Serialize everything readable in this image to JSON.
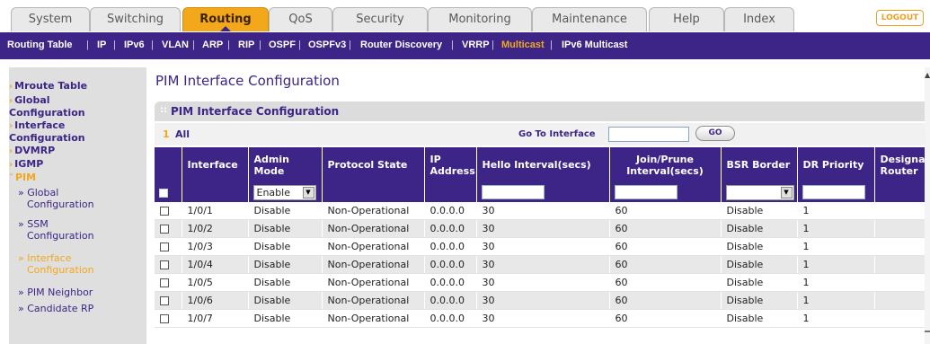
{
  "top_tabs": [
    "System",
    "Switching",
    "Routing",
    "QoS",
    "Security",
    "Monitoring",
    "Maintenance",
    "Help",
    "Index"
  ],
  "active_tab": "Routing",
  "logout_label": "LOGOUT",
  "sub_nav": [
    "Routing Table",
    "IP",
    "IPv6",
    "VLAN",
    "ARP",
    "RIP",
    "OSPF",
    "OSPFv3",
    "Router Discovery",
    "VRRP",
    "Multicast",
    "IPv6 Multicast"
  ],
  "active_sub_nav": "Multicast",
  "sidebar": {
    "items": [
      {
        "label": "Mroute Table"
      },
      {
        "label_line1": "Global",
        "label_line2": "Configuration"
      },
      {
        "label_line1": "Interface",
        "label_line2": "Configuration"
      },
      {
        "label": "DVMRP"
      },
      {
        "label": "IGMP"
      },
      {
        "label": "PIM"
      }
    ],
    "pim_sub": [
      {
        "line1": "» Global",
        "line2": "Configuration"
      },
      {
        "line1": "» SSM",
        "line2": "Configuration"
      },
      {
        "line1": "» Interface",
        "line2": "Configuration"
      },
      {
        "line1": "» PIM Neighbor"
      },
      {
        "line1": "» Candidate RP"
      }
    ]
  },
  "page_title": "PIM Interface Configuration",
  "panel_title": "PIM Interface Configuration",
  "toolbar": {
    "number": "1",
    "all_label": "All",
    "goto_label": "Go To Interface",
    "go_button": "GO"
  },
  "table": {
    "headers": [
      "Interface",
      "Admin Mode",
      "Protocol State",
      "IP Address",
      "Hello Interval(secs)",
      "Join/Prune Interval(secs)",
      "BSR Border",
      "DR Priority",
      "Designated Router"
    ],
    "edit_row": {
      "admin_mode": "Enable"
    },
    "rows": [
      {
        "interface": "1/0/1",
        "admin_mode": "Disable",
        "protocol_state": "Non-Operational",
        "ip": "0.0.0.0",
        "hello": "30",
        "join_prune": "60",
        "bsr": "Disable",
        "dr": "1"
      },
      {
        "interface": "1/0/2",
        "admin_mode": "Disable",
        "protocol_state": "Non-Operational",
        "ip": "0.0.0.0",
        "hello": "30",
        "join_prune": "60",
        "bsr": "Disable",
        "dr": "1"
      },
      {
        "interface": "1/0/3",
        "admin_mode": "Disable",
        "protocol_state": "Non-Operational",
        "ip": "0.0.0.0",
        "hello": "30",
        "join_prune": "60",
        "bsr": "Disable",
        "dr": "1"
      },
      {
        "interface": "1/0/4",
        "admin_mode": "Disable",
        "protocol_state": "Non-Operational",
        "ip": "0.0.0.0",
        "hello": "30",
        "join_prune": "60",
        "bsr": "Disable",
        "dr": "1"
      },
      {
        "interface": "1/0/5",
        "admin_mode": "Disable",
        "protocol_state": "Non-Operational",
        "ip": "0.0.0.0",
        "hello": "30",
        "join_prune": "60",
        "bsr": "Disable",
        "dr": "1"
      },
      {
        "interface": "1/0/6",
        "admin_mode": "Disable",
        "protocol_state": "Non-Operational",
        "ip": "0.0.0.0",
        "hello": "30",
        "join_prune": "60",
        "bsr": "Disable",
        "dr": "1"
      },
      {
        "interface": "1/0/7",
        "admin_mode": "Disable",
        "protocol_state": "Non-Operational",
        "ip": "0.0.0.0",
        "hello": "30",
        "join_prune": "60",
        "bsr": "Disable",
        "dr": "1"
      }
    ]
  },
  "colors": {
    "brand_purple": "#3c2587",
    "accent_orange": "#f3a81b"
  }
}
